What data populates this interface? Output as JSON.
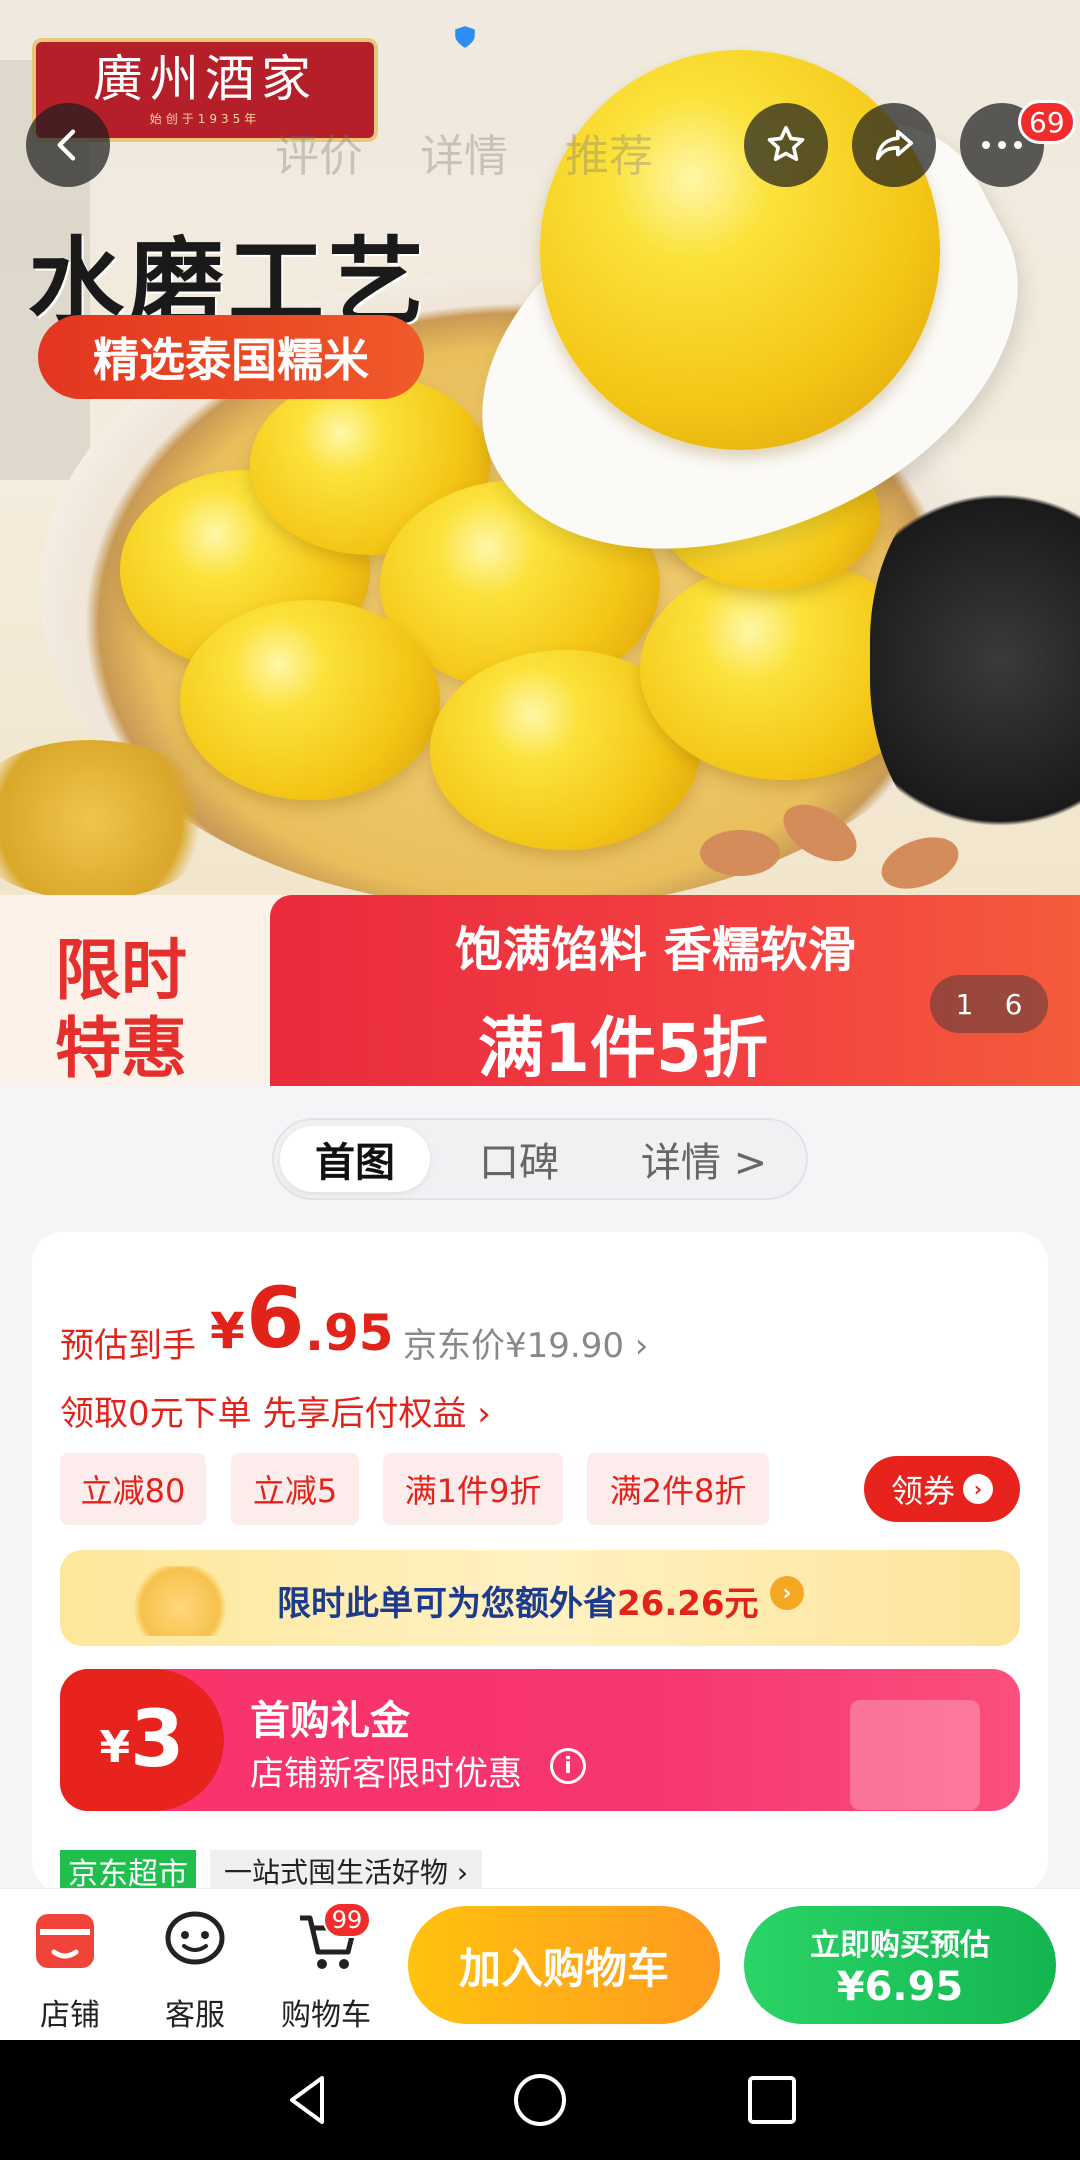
{
  "brand": {
    "logo_text": "廣州酒家",
    "logo_sub": "始创于1935年"
  },
  "nav": {
    "tabs": [
      "评价",
      "详情",
      "推荐"
    ],
    "badge": "69"
  },
  "hero": {
    "headline": "水磨工艺",
    "pill": "精选泰国糯米",
    "banner_left_1": "限时",
    "banner_left_2": "特惠",
    "banner_line1": "饱满馅料 香糯软滑",
    "banner_line2": "满1件5折",
    "counter_current": "1",
    "counter_total": "6"
  },
  "segment": {
    "items": [
      "首图",
      "口碑",
      "详情 >"
    ]
  },
  "price": {
    "label": "预估到手",
    "symbol": "¥",
    "integer": "6",
    "decimal": ".95",
    "jd_price": "京东价¥19.90 ›"
  },
  "promo": {
    "line": "领取0元下单 先享后付权益 ›"
  },
  "coupons": [
    "立减80",
    "立减5",
    "满1件9折",
    "满2件8折"
  ],
  "claim": {
    "label": "领券"
  },
  "savings": {
    "text": "限时此单可为您额外省",
    "amount": "26.26元"
  },
  "gift": {
    "symbol": "¥",
    "amount": "3",
    "title": "首购礼金",
    "subtitle": "店铺新客限时优惠"
  },
  "jd_market": {
    "tag": "京东超市",
    "desc": "一站式囤生活好物 ›"
  },
  "bottom": {
    "store": "店铺",
    "service": "客服",
    "cart": "购物车",
    "cart_badge": "99",
    "add_to_cart": "加入购物车",
    "buy_line1": "立即购买预估",
    "buy_line2": "¥6.95"
  },
  "colors": {
    "accent_red": "#e2231a",
    "buy_green": "#14b550",
    "cart_orange": "#ff9a1f"
  }
}
